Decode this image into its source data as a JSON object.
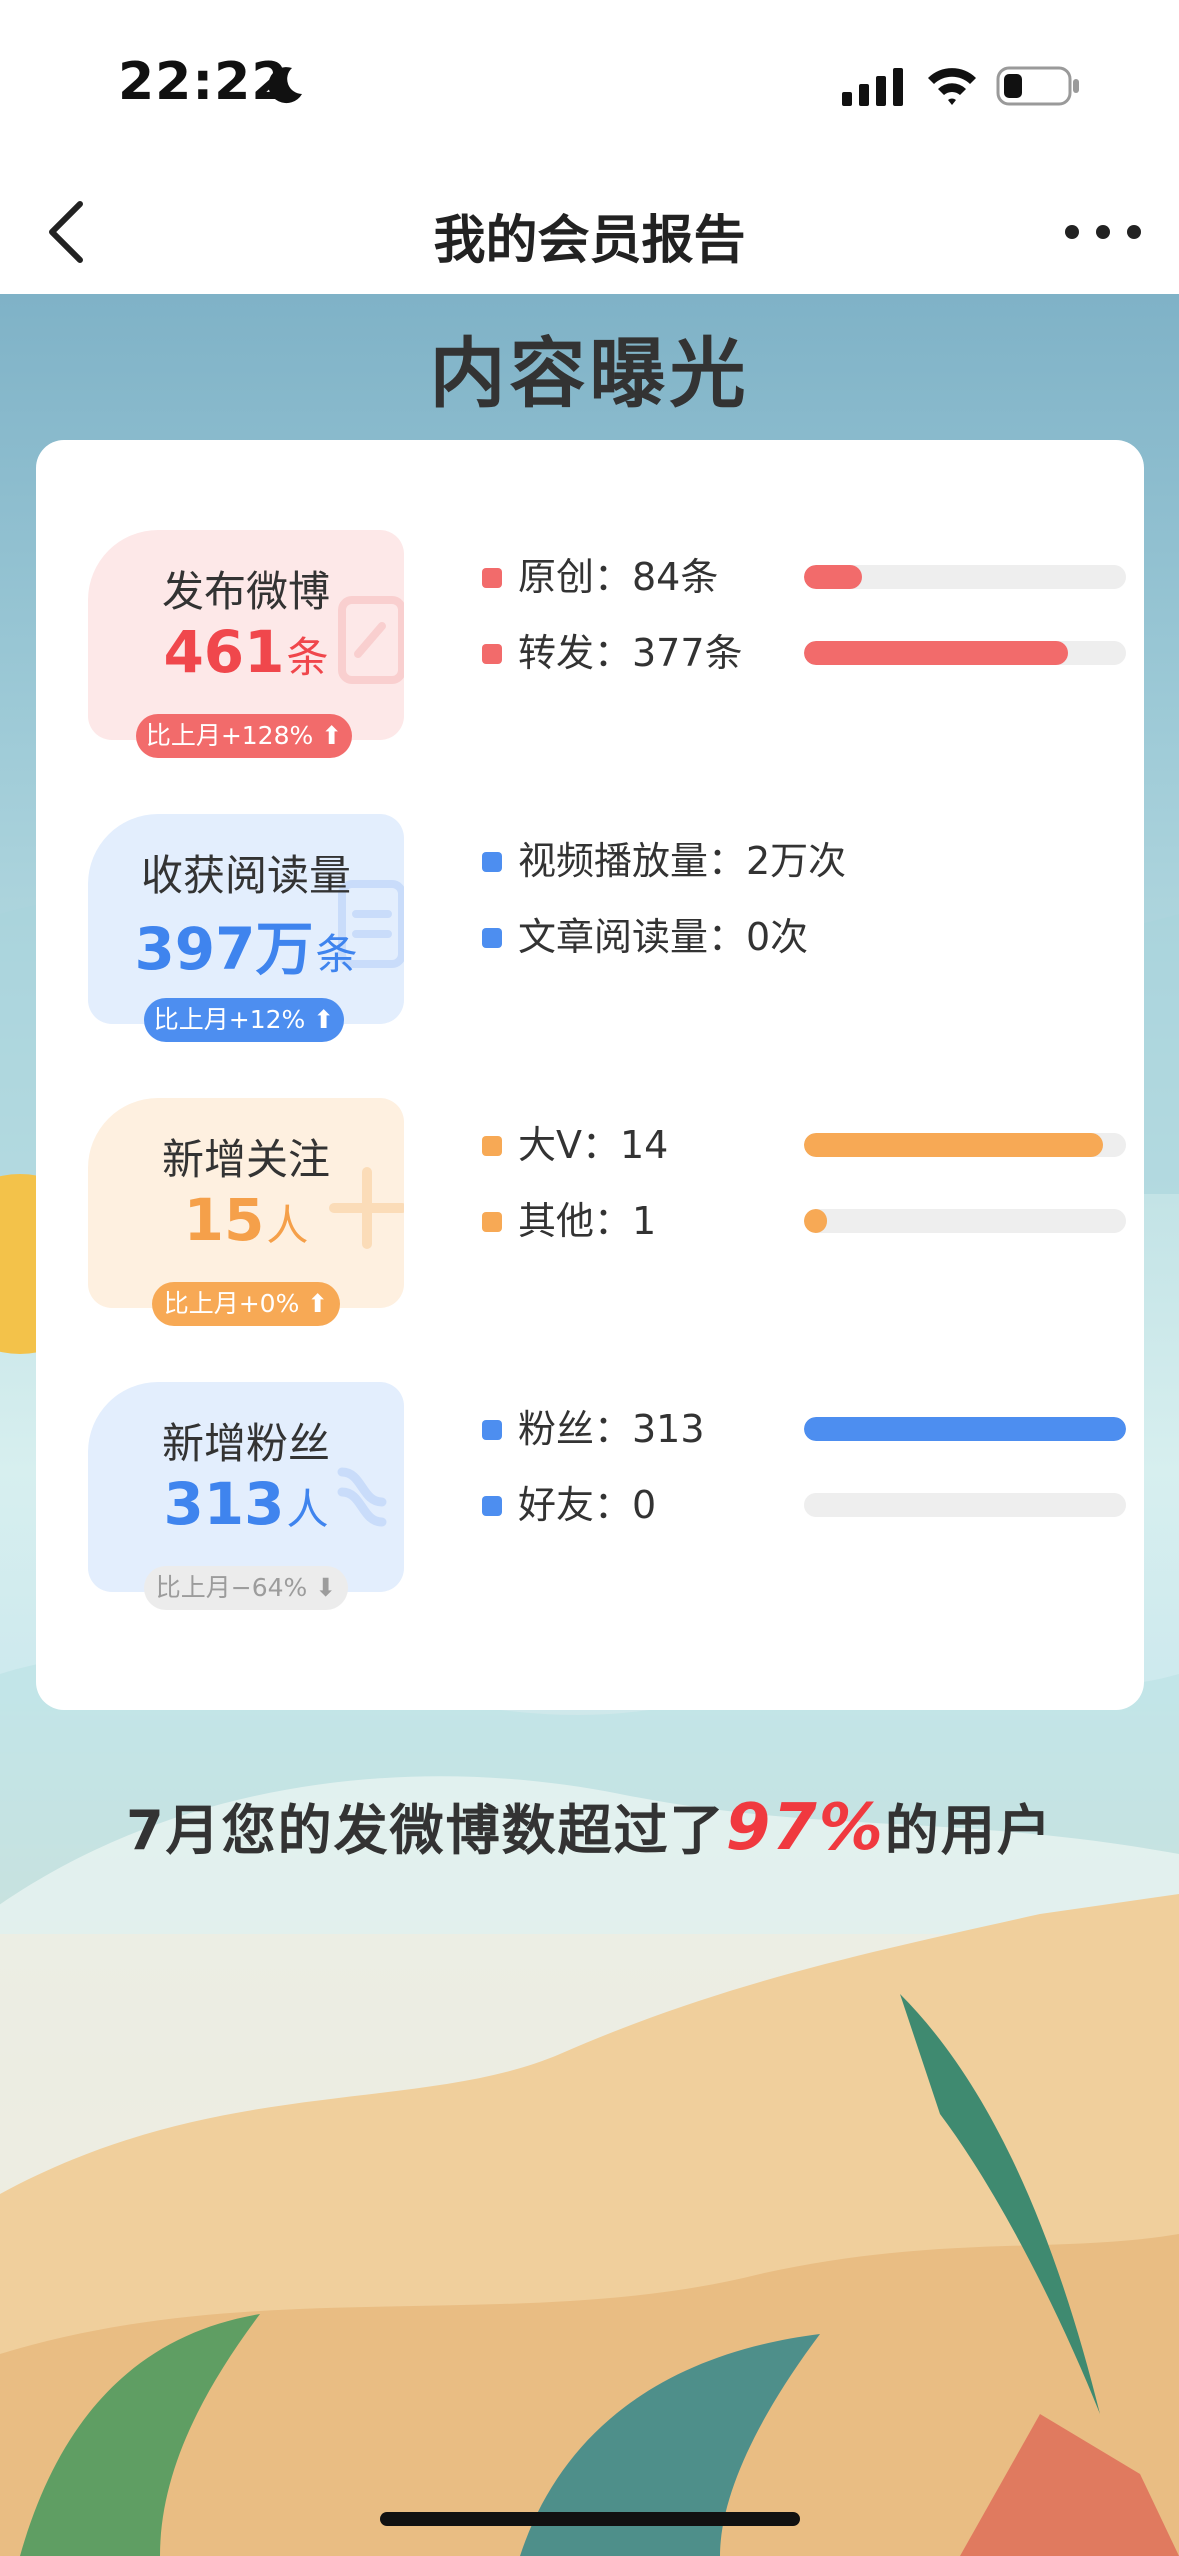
{
  "status_bar": {
    "time": "22:22"
  },
  "nav": {
    "title": "我的会员报告"
  },
  "section_title": "内容曝光",
  "colors": {
    "red": "#f26b6b",
    "blue": "#4d8ef0",
    "orange": "#f7a955",
    "gray": "#9c9c9c"
  },
  "rows": [
    {
      "label": "发布微博",
      "value": "461",
      "unit": "条",
      "change": "比上月+128% ⬆",
      "stats": [
        {
          "label": "原创：84条",
          "fraction": 0.18
        },
        {
          "label": "转发：377条",
          "fraction": 0.82
        }
      ]
    },
    {
      "label": "收获阅读量",
      "value": "397万",
      "unit": "条",
      "change": "比上月+12% ⬆",
      "stats": [
        {
          "label": "视频播放量：2万次"
        },
        {
          "label": "文章阅读量：0次"
        }
      ]
    },
    {
      "label": "新增关注",
      "value": "15",
      "unit": "人",
      "change": "比上月+0% ⬆",
      "stats": [
        {
          "label": "大V：14",
          "fraction": 0.93
        },
        {
          "label": "其他：1",
          "fraction": 0.07
        }
      ]
    },
    {
      "label": "新增粉丝",
      "value": "313",
      "unit": "人",
      "change": "比上月−64% ⬇",
      "stats": [
        {
          "label": "粉丝：313",
          "fraction": 1.0
        },
        {
          "label": "好友：0",
          "fraction": 0.0
        }
      ]
    }
  ],
  "summary": {
    "prefix": "7月您的发微博数超过了",
    "highlight": "97%",
    "suffix": "的用户"
  }
}
